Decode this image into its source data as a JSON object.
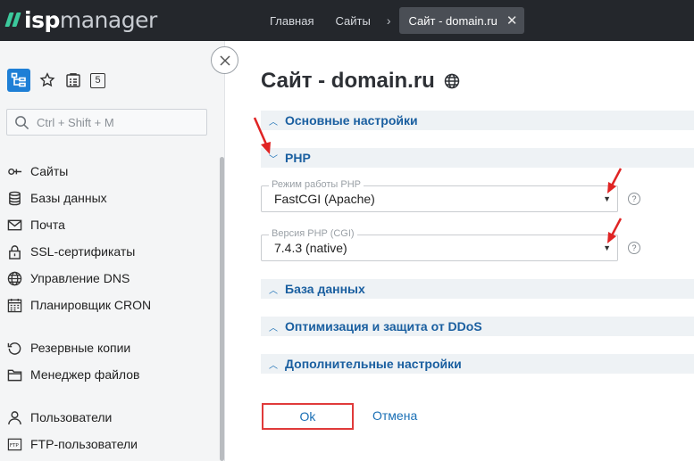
{
  "header": {
    "logo_isp": "isp",
    "logo_manager": "manager",
    "breadcrumbs": [
      "Главная",
      "Сайты"
    ],
    "separator": "›",
    "active_tab": "Сайт - domain.ru",
    "close": "✕"
  },
  "sidebar": {
    "badge_count": "5",
    "search_placeholder": "Ctrl + Shift + M",
    "items": [
      {
        "label": "Сайты",
        "icon": "sites-icon"
      },
      {
        "label": "Базы данных",
        "icon": "database-icon"
      },
      {
        "label": "Почта",
        "icon": "mail-icon"
      },
      {
        "label": "SSL-сертификаты",
        "icon": "lock-icon"
      },
      {
        "label": "Управление DNS",
        "icon": "globe-icon"
      },
      {
        "label": "Планировщик CRON",
        "icon": "calendar-icon"
      },
      {
        "label": "Резервные копии",
        "icon": "backup-icon"
      },
      {
        "label": "Менеджер файлов",
        "icon": "folder-icon"
      },
      {
        "label": "Пользователи",
        "icon": "user-icon"
      },
      {
        "label": "FTP-пользователи",
        "icon": "ftp-icon"
      }
    ]
  },
  "main": {
    "title": "Сайт - domain.ru",
    "sections": {
      "basic": "Основные настройки",
      "php": "PHP",
      "db": "База данных",
      "ddos": "Оптимизация и защита от DDoS",
      "extra": "Дополнительные настройки"
    },
    "fields": {
      "php_mode": {
        "label": "Режим работы PHP",
        "value": "FastCGI (Apache)"
      },
      "php_version": {
        "label": "Версия PHP (CGI)",
        "value": "7.4.3 (native)"
      }
    },
    "help": "?",
    "ok_label": "Ok",
    "cancel_label": "Отмена"
  },
  "colors": {
    "topbar": "#24272c",
    "accent": "#1e7fd6",
    "link": "#1a6fb5",
    "highlight": "#e03a3a",
    "logo_green": "#3cc99c"
  }
}
